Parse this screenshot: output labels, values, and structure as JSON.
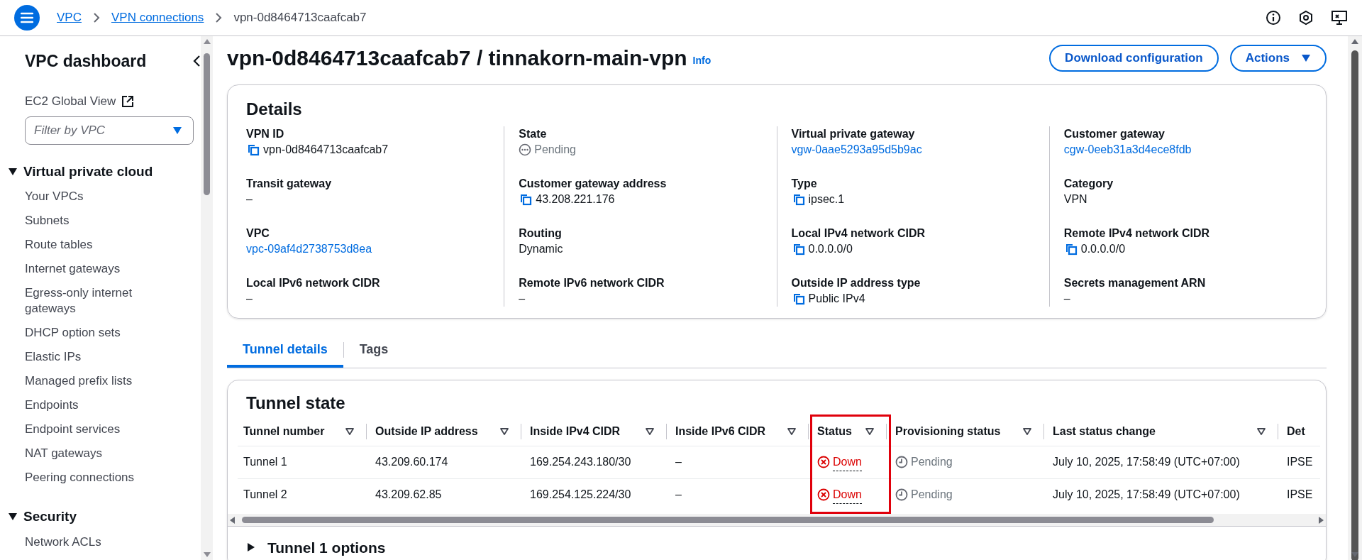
{
  "breadcrumbs": [
    {
      "label": "VPC",
      "link": true
    },
    {
      "label": "VPN connections",
      "link": true
    },
    {
      "label": "vpn-0d8464713caafcab7",
      "link": false
    }
  ],
  "sidebar": {
    "title": "VPC dashboard",
    "global_view": "EC2 Global View",
    "filter": {
      "placeholder": "Filter by VPC"
    },
    "sections": [
      {
        "title": "Virtual private cloud",
        "expanded": true,
        "items": [
          "Your VPCs",
          "Subnets",
          "Route tables",
          "Internet gateways",
          "Egress-only internet gateways",
          "DHCP option sets",
          "Elastic IPs",
          "Managed prefix lists",
          "Endpoints",
          "Endpoint services",
          "NAT gateways",
          "Peering connections"
        ]
      },
      {
        "title": "Security",
        "expanded": true,
        "items": [
          "Network ACLs"
        ]
      }
    ]
  },
  "page": {
    "title": "vpn-0d8464713caafcab7 / tinnakorn-main-vpn",
    "info": "Info",
    "buttons": [
      {
        "label": "Download configuration",
        "kind": "button"
      },
      {
        "label": "Actions",
        "kind": "dropdown"
      }
    ]
  },
  "details": {
    "title": "Details",
    "columns": [
      [
        {
          "label": "VPN ID",
          "value": "vpn-0d8464713caafcab7",
          "kind": "copy"
        },
        {
          "label": "Transit gateway",
          "value": "–",
          "kind": "text"
        },
        {
          "label": "VPC",
          "value": "vpc-09af4d2738753d8ea",
          "kind": "link"
        },
        {
          "label": "Local IPv6 network CIDR",
          "value": "–",
          "kind": "text"
        }
      ],
      [
        {
          "label": "State",
          "value": "Pending",
          "kind": "pending"
        },
        {
          "label": "Customer gateway address",
          "value": "43.208.221.176",
          "kind": "copy"
        },
        {
          "label": "Routing",
          "value": "Dynamic",
          "kind": "text"
        },
        {
          "label": "Remote IPv6 network CIDR",
          "value": "–",
          "kind": "text"
        }
      ],
      [
        {
          "label": "Virtual private gateway",
          "value": "vgw-0aae5293a95d5b9ac",
          "kind": "link"
        },
        {
          "label": "Type",
          "value": "ipsec.1",
          "kind": "copy"
        },
        {
          "label": "Local IPv4 network CIDR",
          "value": "0.0.0.0/0",
          "kind": "copy"
        },
        {
          "label": "Outside IP address type",
          "value": "Public IPv4",
          "kind": "copy"
        }
      ],
      [
        {
          "label": "Customer gateway",
          "value": "cgw-0eeb31a3d4ece8fdb",
          "kind": "link"
        },
        {
          "label": "Category",
          "value": "VPN",
          "kind": "text"
        },
        {
          "label": "Remote IPv4 network CIDR",
          "value": "0.0.0.0/0",
          "kind": "copy"
        },
        {
          "label": "Secrets management ARN",
          "value": "–",
          "kind": "text"
        }
      ]
    ]
  },
  "tabs": [
    {
      "label": "Tunnel details",
      "selected": true
    },
    {
      "label": "Tags",
      "selected": false
    }
  ],
  "tunnel_state": {
    "title": "Tunnel state",
    "columns": [
      {
        "label": "Tunnel number",
        "kind": "text",
        "highlighted": false
      },
      {
        "label": "Outside IP address",
        "kind": "text",
        "highlighted": false
      },
      {
        "label": "Inside IPv4 CIDR",
        "kind": "text",
        "highlighted": false
      },
      {
        "label": "Inside IPv6 CIDR",
        "kind": "text",
        "highlighted": false
      },
      {
        "label": "Status",
        "kind": "error",
        "highlighted": true
      },
      {
        "label": "Provisioning status",
        "kind": "pending",
        "highlighted": false
      },
      {
        "label": "Last status change",
        "kind": "text",
        "highlighted": false
      },
      {
        "label": "Det",
        "kind": "text",
        "highlighted": false
      }
    ],
    "rows": [
      [
        "Tunnel 1",
        "43.209.60.174",
        "169.254.243.180/30",
        "–",
        "Down",
        "Pending",
        "July 10, 2025, 17:58:49 (UTC+07:00)",
        "IPSE"
      ],
      [
        "Tunnel 2",
        "43.209.62.85",
        "169.254.125.224/30",
        "–",
        "Down",
        "Pending",
        "July 10, 2025, 17:58:49 (UTC+07:00)",
        "IPSE"
      ]
    ]
  },
  "sections": [
    {
      "title": "Tunnel 1 options",
      "expanded": false
    }
  ]
}
